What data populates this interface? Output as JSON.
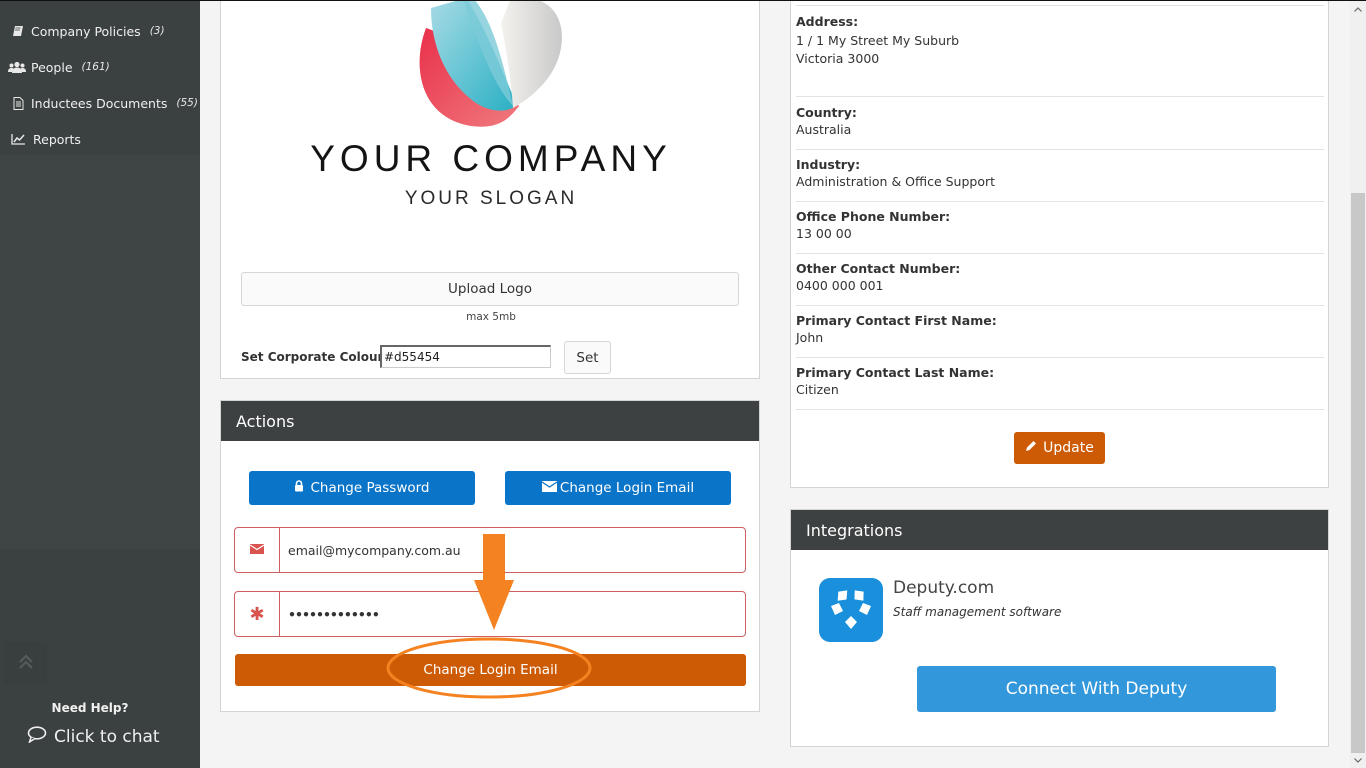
{
  "sidebar": {
    "items": [
      {
        "label": "Company Policies",
        "count": "(3)",
        "icon": "book-icon"
      },
      {
        "label": "People",
        "count": "(161)",
        "icon": "users-icon"
      },
      {
        "label": "Inductees Documents",
        "count": "(55)",
        "icon": "document-icon"
      },
      {
        "label": "Reports",
        "count": "",
        "icon": "chart-line-icon"
      }
    ],
    "need_help": "Need Help?",
    "chat_label": "Click to chat"
  },
  "logo_panel": {
    "company_name": "YOUR COMPANY",
    "slogan": "YOUR SLOGAN",
    "upload_label": "Upload Logo",
    "max_size": "max 5mb",
    "colour_label": "Set Corporate Colour:",
    "colour_value": "#d55454",
    "set_label": "Set"
  },
  "actions": {
    "title": "Actions",
    "change_password": "Change Password",
    "change_login_email": "Change Login Email",
    "email_value": "email@mycompany.com.au",
    "password_value": "•••••••••••••",
    "submit_label": "Change Login Email"
  },
  "company_info": {
    "rows": [
      {
        "label": "Address:",
        "value": "1 / 1 My Street My Suburb",
        "value2": "Victoria 3000"
      },
      {
        "label": "Country:",
        "value": "Australia"
      },
      {
        "label": "Industry:",
        "value": "Administration & Office Support"
      },
      {
        "label": "Office Phone Number:",
        "value": "13 00 00"
      },
      {
        "label": "Other Contact Number:",
        "value": "0400 000 001"
      },
      {
        "label": "Primary Contact First Name:",
        "value": "John"
      },
      {
        "label": "Primary Contact Last Name:",
        "value": "Citizen"
      }
    ],
    "update_label": "Update"
  },
  "integrations": {
    "title": "Integrations",
    "deputy_name": "Deputy.com",
    "deputy_desc": "Staff management software",
    "connect_label": "Connect With Deputy"
  },
  "colors": {
    "sidebar": "#3f4545",
    "panel_header": "#3d4141",
    "primary_blue": "#0a74c8",
    "orange": "#cd5a04",
    "deputy_blue": "#1a8fdb",
    "connect_blue": "#3398db",
    "annotation": "#f58220"
  }
}
